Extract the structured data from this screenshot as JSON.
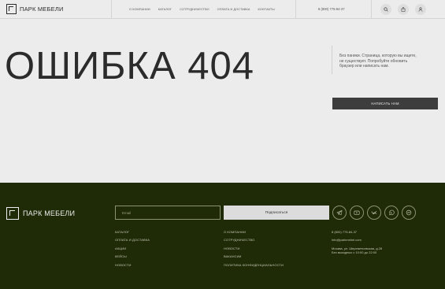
{
  "header": {
    "logo_text": "ПАРК МЕБЕЛИ",
    "nav": [
      {
        "label": "О КОМПАНИИ"
      },
      {
        "label": "КАТАЛОГ"
      },
      {
        "label": "СОТРУДНИЧЕСТВО"
      },
      {
        "label": "ОПЛАТА И ДОСТАВКА"
      },
      {
        "label": "КОНТАКТЫ"
      }
    ],
    "phone": "8 (800) 775-84-37",
    "icons": [
      "search-icon",
      "cart-icon",
      "user-icon"
    ]
  },
  "error": {
    "title": "ОШИБКА 404",
    "message": "Без паники. Страница, которую вы ищете, не существует. Попробуйте обновить браузер или написать нам.",
    "button_label": "НАПИСАТЬ НАМ"
  },
  "footer": {
    "logo_text": "ПАРК МЕБЕЛИ",
    "email_placeholder": "Email",
    "subscribe_label": "Подписаться",
    "social_icons": [
      "telegram-icon",
      "youtube-icon",
      "vk-icon",
      "whatsapp-icon",
      "messenger-icon"
    ],
    "links_col1": [
      {
        "label": "КАТАЛОГ"
      },
      {
        "label": "ОПЛАТА И ДОСТАВКА"
      },
      {
        "label": "АКЦИИ"
      },
      {
        "label": "КЕЙСЫ"
      },
      {
        "label": "НОВОСТИ"
      }
    ],
    "links_col2": [
      {
        "label": "О КОМПАНИИ"
      },
      {
        "label": "СОТРУДНИЧЕСТВО"
      },
      {
        "label": "НОВОСТИ"
      },
      {
        "label": "ВАКАНСИИ"
      },
      {
        "label": "ПОЛИТИКА КОНФИДЕНЦИАЛЬНОСТИ"
      }
    ],
    "contact": {
      "phone": "8 (800) 775-84-37",
      "email": "info@parkmebel.com",
      "address": "Москва, ул. Шереметьевская, д.28",
      "hours": "Без выходных с 10:00 до 22:00"
    }
  },
  "colors": {
    "background": "#ececec",
    "footer_bg": "#1f2a07",
    "button_dark": "#3d3d3d",
    "text": "#2b2b2b"
  }
}
